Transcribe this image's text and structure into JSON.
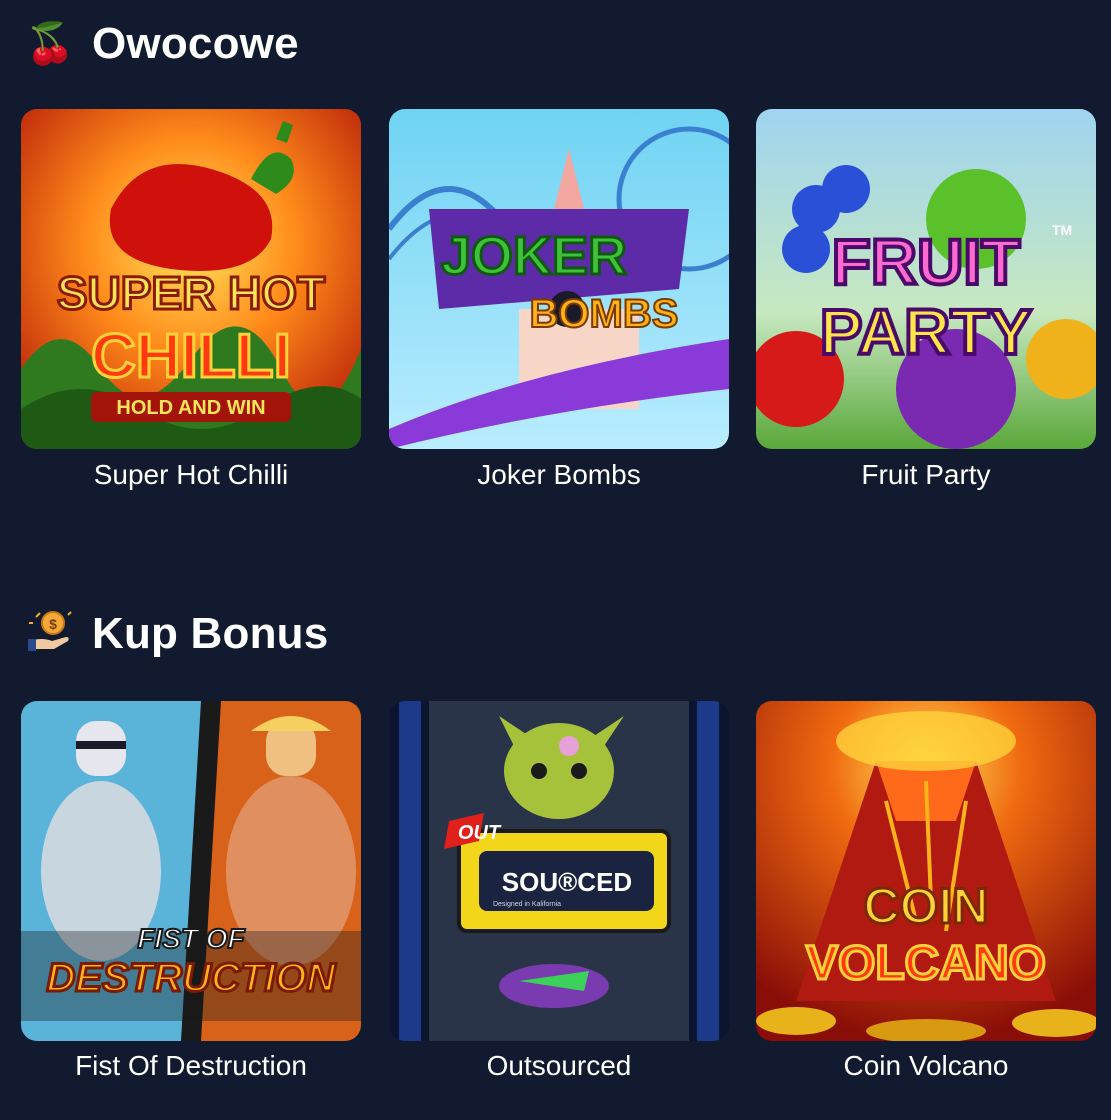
{
  "sections": [
    {
      "title": "Owocowe",
      "icon": "cherries-icon",
      "emoji": "🍒",
      "games": [
        {
          "name": "Super Hot Chilli",
          "art": [
            "SUPER HOT",
            "CHILLI",
            "HOLD AND WIN"
          ]
        },
        {
          "name": "Joker Bombs",
          "art": [
            "JOKER",
            "BOMBS"
          ]
        },
        {
          "name": "Fruit Party",
          "art": [
            "FRUIT",
            "PARTY",
            "TM"
          ]
        }
      ]
    },
    {
      "title": "Kup Bonus",
      "icon": "hand-coin-icon",
      "emoji": "",
      "games": [
        {
          "name": "Fist Of Destruction",
          "art": [
            "FIST OF",
            "DESTRUCTION"
          ]
        },
        {
          "name": "Outsourced",
          "art": [
            "OUT",
            "SOU®CED",
            "Designed in Kalifornia"
          ]
        },
        {
          "name": "Coin Volcano",
          "art": [
            "COIN",
            "VOLCANO"
          ]
        }
      ]
    }
  ]
}
